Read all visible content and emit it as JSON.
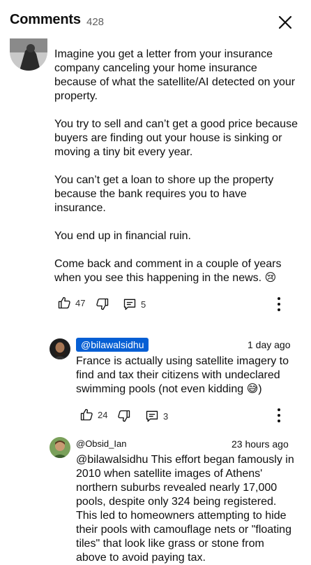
{
  "header": {
    "title": "Comments",
    "count": "428"
  },
  "comment1": {
    "lines": [
      "Imagine you get a letter from your insurance",
      "company canceling your home insurance",
      "because of what the satellite/AI detected on your",
      "property.",
      "",
      "You try to sell and can’t get a good price because",
      "buyers are finding out your house is sinking or",
      "moving a tiny bit every year.",
      "",
      "You can’t get a loan to shore up the property",
      "because the bank requires you to have",
      "insurance.",
      "",
      "You end up in financial ruin.",
      "",
      "Come back and comment in a couple of years",
      "when you see this happening in the news. 😢"
    ],
    "likes": "47",
    "replies": "5"
  },
  "reply1": {
    "handle": "@bilawalsidhu",
    "time": "1 day ago",
    "lines": [
      "France is actually using satellite imagery to",
      "find and tax their citizens with undeclared",
      "swimming pools (not even kidding 😅)"
    ],
    "likes": "24",
    "replies": "3"
  },
  "reply2": {
    "handle": "@Obsid_Ian",
    "time": "23 hours ago",
    "lines": [
      "@bilawalsidhu This effort began famously in",
      "2010 when satellite images of Athens'",
      "northern suburbs revealed nearly 17,000",
      "pools, despite only 324 being registered.",
      "This led to homeowners attempting to hide",
      "their pools with camouflage nets or \"floating",
      "tiles\" that look like grass or stone from",
      "above to avoid paying tax."
    ]
  },
  "colors": {
    "mention_chip": "#065fd4",
    "text": "#0f0f0f",
    "muted": "#606060"
  },
  "icons": [
    "close-icon",
    "thumb-up-icon",
    "thumb-down-icon",
    "reply-icon",
    "more-vert-icon"
  ]
}
